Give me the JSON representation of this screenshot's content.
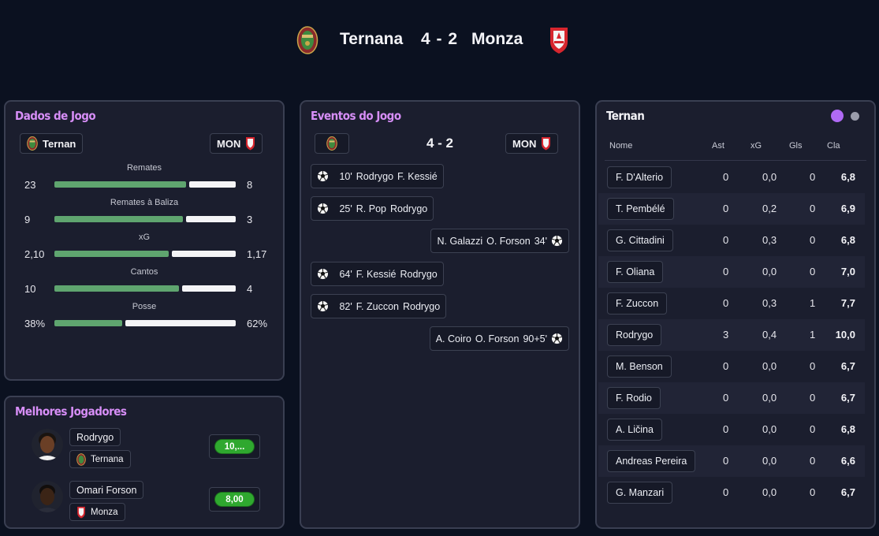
{
  "match": {
    "home_team": "Ternana",
    "away_team": "Monza",
    "score": "4 - 2",
    "home_crest_icon": "ternana-crest-icon",
    "away_crest_icon": "monza-crest-icon"
  },
  "game_stats": {
    "title": "Dados de Jogo",
    "home_chip": "Ternan",
    "away_chip": "MON",
    "stats": [
      {
        "label": "Remates",
        "home": "23",
        "away": "8",
        "home_share": 0.74
      },
      {
        "label": "Remates à Baliza",
        "home": "9",
        "away": "3",
        "home_share": 0.72
      },
      {
        "label": "xG",
        "home": "2,10",
        "away": "1,17",
        "home_share": 0.64
      },
      {
        "label": "Cantos",
        "home": "10",
        "away": "4",
        "home_share": 0.7
      },
      {
        "label": "Posse",
        "home": "38%",
        "away": "62%",
        "home_share": 0.38
      }
    ]
  },
  "events": {
    "title": "Eventos do Jogo",
    "score": "4 - 2",
    "away_chip": "MON",
    "items": [
      {
        "side": "home",
        "minute": "10'",
        "scorer": "Rodrygo",
        "assist": "F. Kessié"
      },
      {
        "side": "home",
        "minute": "25'",
        "scorer": "R. Pop",
        "assist": "Rodrygo"
      },
      {
        "side": "away",
        "minute": "34'",
        "scorer": "N. Galazzi",
        "assist": "O. Forson"
      },
      {
        "side": "home",
        "minute": "64'",
        "scorer": "F. Kessié",
        "assist": "Rodrygo"
      },
      {
        "side": "home",
        "minute": "82'",
        "scorer": "F. Zuccon",
        "assist": "Rodrygo"
      },
      {
        "side": "away",
        "minute": "90+5'",
        "scorer": "A. Coiro",
        "assist": "O. Forson"
      }
    ]
  },
  "top_players": {
    "title": "Melhores Jogadores",
    "players": [
      {
        "name": "Rodrygo",
        "team": "Ternana",
        "rating": "10,...",
        "crest": "ternana-crest-icon"
      },
      {
        "name": "Omari Forson",
        "team": "Monza",
        "rating": "8,00",
        "crest": "monza-crest-icon"
      }
    ]
  },
  "lineup": {
    "title": "Ternan",
    "headers": {
      "name": "Nome",
      "ast": "Ast",
      "xg": "xG",
      "gls": "Gls",
      "rating": "Cla"
    },
    "rows": [
      {
        "name": "F. D'Alterio",
        "ast": "0",
        "xg": "0,0",
        "gls": "0",
        "rating": "6,8"
      },
      {
        "name": "T. Pembélé",
        "ast": "0",
        "xg": "0,2",
        "gls": "0",
        "rating": "6,9"
      },
      {
        "name": "G. Cittadini",
        "ast": "0",
        "xg": "0,3",
        "gls": "0",
        "rating": "6,8"
      },
      {
        "name": "F. Oliana",
        "ast": "0",
        "xg": "0,0",
        "gls": "0",
        "rating": "7,0"
      },
      {
        "name": "F. Zuccon",
        "ast": "0",
        "xg": "0,3",
        "gls": "1",
        "rating": "7,7"
      },
      {
        "name": "Rodrygo",
        "ast": "3",
        "xg": "0,4",
        "gls": "1",
        "rating": "10,0"
      },
      {
        "name": "M. Benson",
        "ast": "0",
        "xg": "0,0",
        "gls": "0",
        "rating": "6,7"
      },
      {
        "name": "F. Rodio",
        "ast": "0",
        "xg": "0,0",
        "gls": "0",
        "rating": "6,7"
      },
      {
        "name": "A. Ličina",
        "ast": "0",
        "xg": "0,0",
        "gls": "0",
        "rating": "6,8"
      },
      {
        "name": "Andreas Pereira",
        "ast": "0",
        "xg": "0,0",
        "gls": "0",
        "rating": "6,6"
      },
      {
        "name": "G. Manzari",
        "ast": "0",
        "xg": "0,0",
        "gls": "0",
        "rating": "6,7"
      }
    ]
  },
  "colors": {
    "accent_title": "#d78ef7",
    "home_bar": "#5fa56f",
    "away_bar": "#f4f4f6",
    "rating_pill": "#2fa82f",
    "toggle_active": "#b06af5",
    "toggle_inactive": "#9a9cab"
  }
}
